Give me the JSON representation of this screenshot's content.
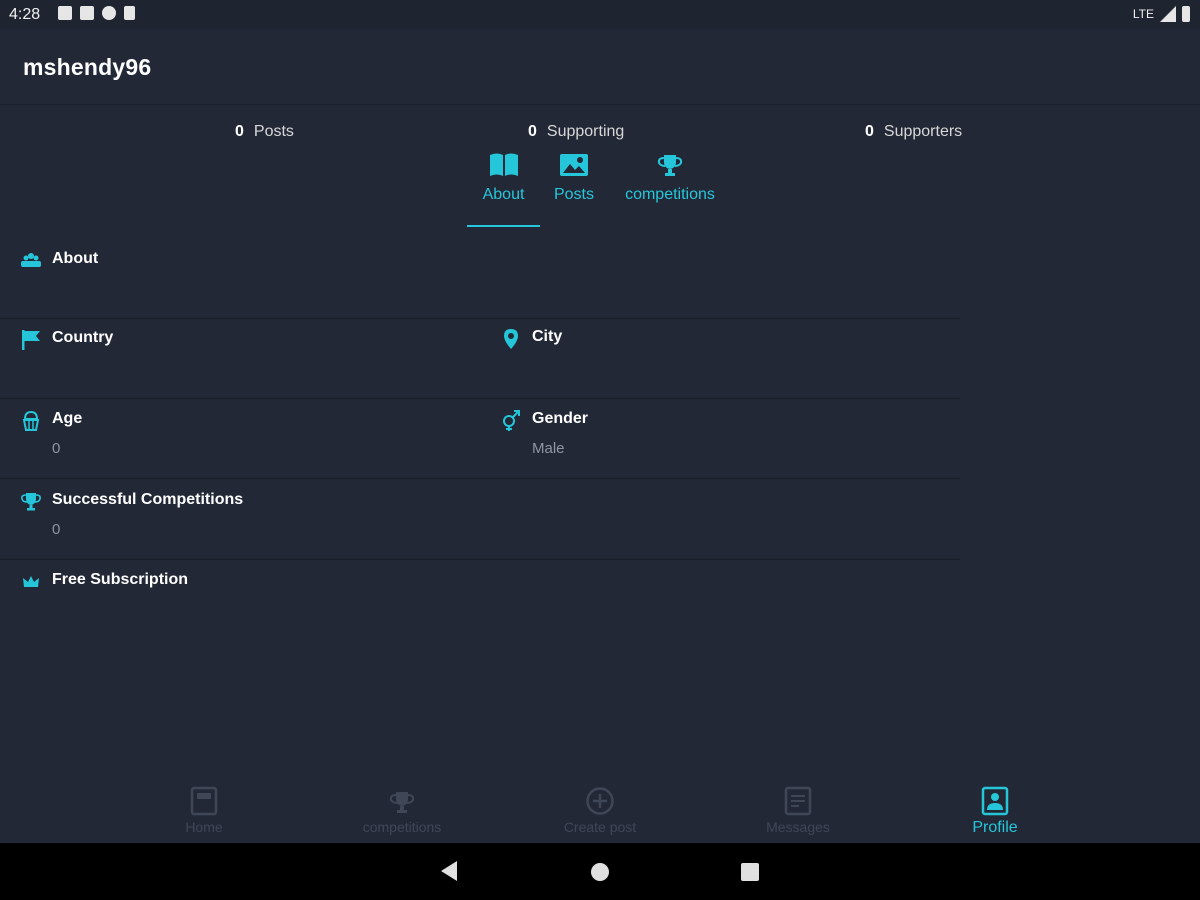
{
  "status_bar": {
    "time": "4:28",
    "network": "LTE"
  },
  "header": {
    "username": "mshendy96"
  },
  "stats": [
    {
      "value": "0",
      "label": "Posts"
    },
    {
      "value": "0",
      "label": "Supporting"
    },
    {
      "value": "0",
      "label": "Supporters"
    }
  ],
  "tabs": [
    {
      "label": "About",
      "icon": "book-icon",
      "active": true
    },
    {
      "label": "Posts",
      "icon": "image-icon",
      "active": false
    },
    {
      "label": "competitions",
      "icon": "trophy-icon",
      "active": false
    }
  ],
  "fields": {
    "about": {
      "label": "About",
      "value": ""
    },
    "country": {
      "label": "Country",
      "value": ""
    },
    "city": {
      "label": "City",
      "value": ""
    },
    "age": {
      "label": "Age",
      "value": "0"
    },
    "gender": {
      "label": "Gender",
      "value": "Male"
    },
    "successful_competitions": {
      "label": "Successful Competitions",
      "value": "0"
    },
    "subscription": {
      "label": "Free Subscription"
    }
  },
  "bottom_nav": [
    {
      "label": "Home",
      "icon": "home-icon"
    },
    {
      "label": "competitions",
      "icon": "trophy-icon"
    },
    {
      "label": "Create post",
      "icon": "plus-circle-icon"
    },
    {
      "label": "Messages",
      "icon": "message-icon"
    },
    {
      "label": "Profile",
      "icon": "profile-icon",
      "active": true
    }
  ],
  "colors": {
    "accent": "#26c6da",
    "background": "#222836",
    "muted": "#3f4656"
  }
}
